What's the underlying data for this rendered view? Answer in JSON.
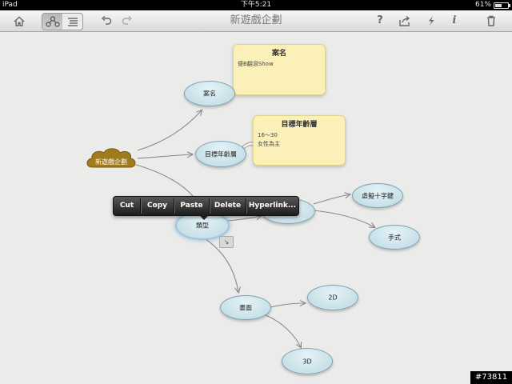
{
  "status_bar": {
    "carrier": "iPad",
    "time": "下午5:21",
    "battery": "61%"
  },
  "toolbar": {
    "title": "新遊戲企劃",
    "home_icon": "home-icon",
    "view_modes": [
      "mindmap-view-icon",
      "outline-view-icon"
    ],
    "selected_view": "mindmap",
    "undo_icon": "undo-icon",
    "redo_icon": "redo-icon",
    "help_label": "?",
    "share_icon": "share-icon",
    "action_icon": "lightning-icon",
    "info_label": "i",
    "trash_icon": "trash-icon"
  },
  "mindmap": {
    "root": "新遊戲企劃",
    "nodes": {
      "case": "案名",
      "age": "目標年齡層",
      "type": "類型",
      "type_child": "",
      "cross": "虛擬十字鍵",
      "hand": "手式",
      "graphics": "畫面",
      "g2d": "2D",
      "g3d": "3D"
    },
    "notes": [
      {
        "title": "案名",
        "lines": [
          "便B翻滾Show"
        ]
      },
      {
        "title": "目標年齡層",
        "lines": [
          "16～30",
          "女性為主"
        ]
      }
    ]
  },
  "context_menu": {
    "items": [
      "Cut",
      "Copy",
      "Paste",
      "Delete",
      "Hyperlink..."
    ]
  },
  "colors": {
    "node_fill": "#cfe6ee",
    "node_border": "#7fa3b4",
    "note_fill": "#fbf1b8",
    "cloud": "#a07b1e",
    "connector": "#8a8a8a"
  },
  "watermark": "#73811"
}
